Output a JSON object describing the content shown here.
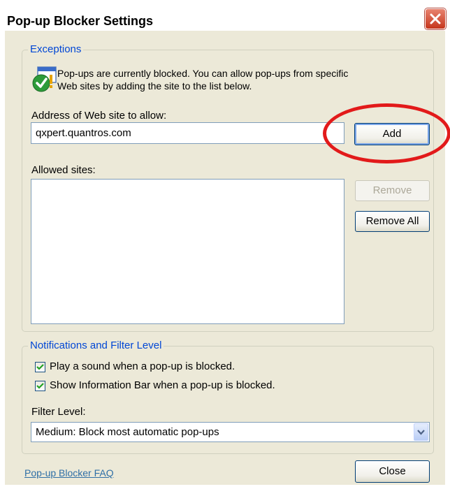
{
  "window": {
    "title": "Pop-up Blocker Settings"
  },
  "exceptions": {
    "legend": "Exceptions",
    "info_line1": "Pop-ups are currently blocked.  You can allow pop-ups from specific",
    "info_line2": "Web sites by adding the site to the list below.",
    "address_label": "Address of Web site to allow:",
    "address_value": "qxpert.quantros.com",
    "add_label": "Add",
    "allowed_label": "Allowed sites:",
    "allowed_sites": [],
    "remove_label": "Remove",
    "remove_all_label": "Remove All"
  },
  "notifications": {
    "legend": "Notifications and Filter Level",
    "play_sound_label": "Play a sound when a pop-up is blocked.",
    "play_sound_checked": true,
    "show_infobar_label": "Show Information Bar when a pop-up is blocked.",
    "show_infobar_checked": true,
    "filter_label": "Filter Level:",
    "filter_value": "Medium: Block most automatic pop-ups"
  },
  "footer": {
    "faq_link": "Pop-up Blocker FAQ",
    "close_label": "Close"
  },
  "colors": {
    "legend": "#0046d5",
    "annotation": "#e21a1a",
    "dialog_bg": "#ece9d8"
  },
  "icons": {
    "info_icon": "shield-check-warning-icon",
    "close": "close-x-icon",
    "dropdown": "chevron-down-icon"
  }
}
